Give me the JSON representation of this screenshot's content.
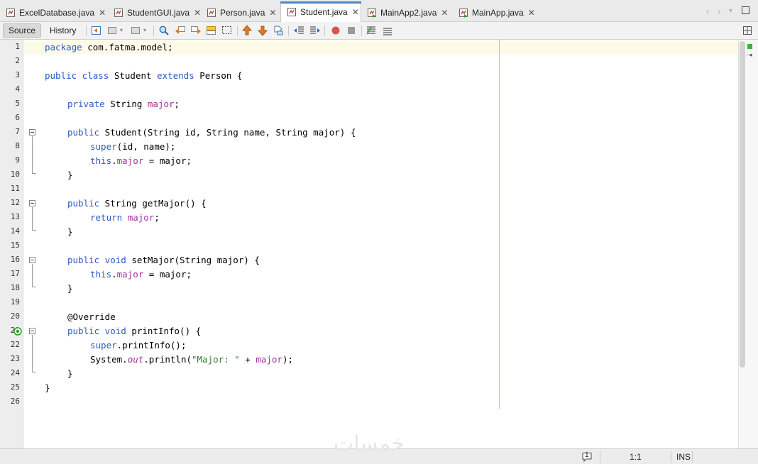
{
  "tabs": [
    {
      "label": "ExcelDatabase.java",
      "active": false,
      "icon": "java-file-icon"
    },
    {
      "label": "StudentGUI.java",
      "active": false,
      "icon": "java-file-icon"
    },
    {
      "label": "Person.java",
      "active": false,
      "icon": "java-file-icon"
    },
    {
      "label": "Student.java",
      "active": true,
      "icon": "java-file-icon"
    },
    {
      "label": "MainApp2.java",
      "active": false,
      "icon": "java-main-file-icon"
    },
    {
      "label": "MainApp.java",
      "active": false,
      "icon": "java-main-file-icon"
    }
  ],
  "toolbar": {
    "source_label": "Source",
    "history_label": "History"
  },
  "editor": {
    "line_numbers": [
      "1",
      "2",
      "3",
      "4",
      "5",
      "6",
      "7",
      "8",
      "9",
      "10",
      "11",
      "12",
      "13",
      "14",
      "15",
      "16",
      "17",
      "18",
      "19",
      "20",
      "21",
      "22",
      "23",
      "24",
      "25",
      "26"
    ],
    "code": {
      "l1_kw": "package",
      "l1_rest": " com.fatma.model;",
      "l3_kw1": "public class",
      "l3_mid": " Student ",
      "l3_kw2": "extends",
      "l3_rest": " Person {",
      "l5_kw": "private",
      "l5_mid": " String ",
      "l5_fld": "major",
      "l5_end": ";",
      "l7_kw": "public",
      "l7_rest": " Student(String id, String name, String major) {",
      "l8_kw": "super",
      "l8_rest": "(id, name);",
      "l9_kw": "this",
      "l9_dot": ".",
      "l9_fld": "major",
      "l9_rest": " = major;",
      "l10": "}",
      "l12_kw": "public",
      "l12_rest": " String getMajor() {",
      "l13_kw": "return",
      "l13_sp": " ",
      "l13_fld": "major",
      "l13_end": ";",
      "l14": "}",
      "l16_kw": "public void",
      "l16_rest": " setMajor(String major) {",
      "l17_kw": "this",
      "l17_dot": ".",
      "l17_fld": "major",
      "l17_rest": " = major;",
      "l18": "}",
      "l20": "@Override",
      "l21_kw": "public void",
      "l21_rest": " printInfo() {",
      "l22_kw": "super",
      "l22_rest": ".printInfo();",
      "l23_a": "System.",
      "l23_sfld": "out",
      "l23_b": ".println(",
      "l23_str": "\"Major: \"",
      "l23_c": " + ",
      "l23_fld": "major",
      "l23_d": ");",
      "l24": "}",
      "l25": "}"
    }
  },
  "status": {
    "notifications": "1",
    "position": "1:1",
    "mode": "INS"
  },
  "watermark": "خمسات",
  "colors": {
    "keyword": "#2b59c3",
    "field": "#a0329c",
    "string": "#2e7d32",
    "current_line": "#fdfbe8",
    "active_tab_accent": "#4a88c7"
  }
}
